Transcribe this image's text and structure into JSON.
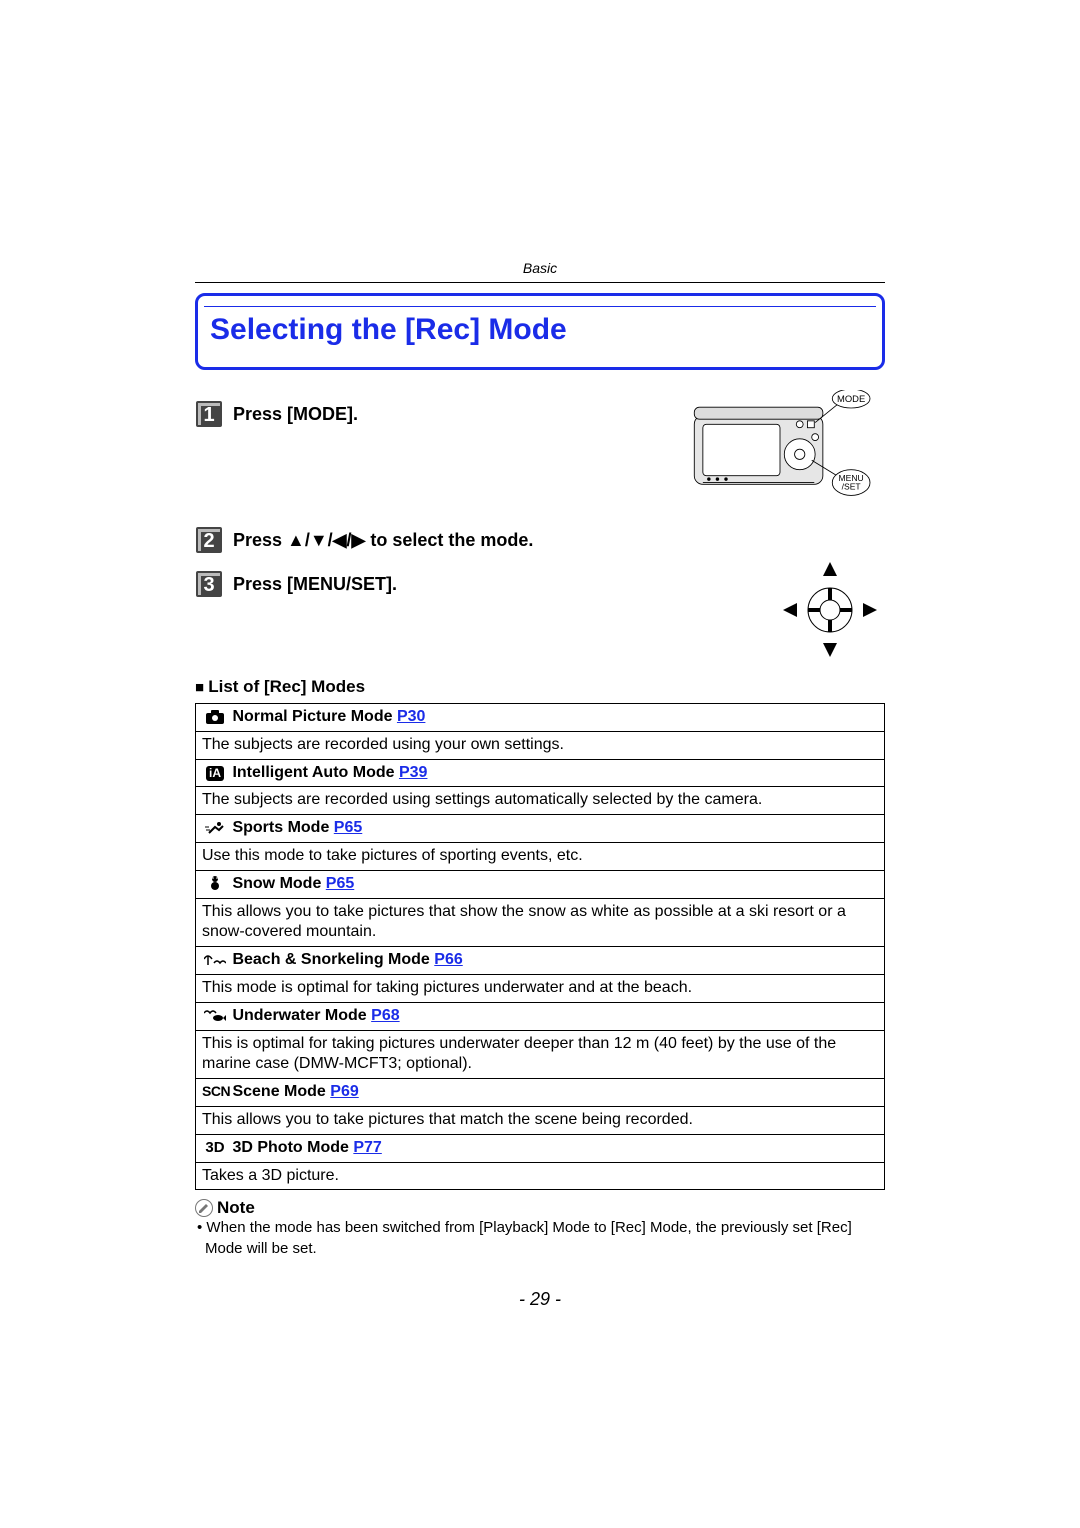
{
  "chapter": "Basic",
  "title": "Selecting the [Rec] Mode",
  "steps": [
    {
      "n": "1",
      "text": "Press [MODE]."
    },
    {
      "n": "2",
      "text": "Press ▲/▼/◀/▶ to select the mode."
    },
    {
      "n": "3",
      "text": "Press [MENU/SET]."
    }
  ],
  "buttons": {
    "mode": "MODE",
    "menu1": "MENU",
    "menu2": "/SET"
  },
  "list_heading": "List of [Rec] Modes",
  "modes": [
    {
      "icon": "camera-icon",
      "name": "Normal Picture Mode",
      "page": "P30",
      "desc": "The subjects are recorded using your own settings."
    },
    {
      "icon": "ia-icon",
      "name": "Intelligent Auto Mode",
      "page": "P39",
      "desc": "The subjects are recorded using settings automatically selected by the camera."
    },
    {
      "icon": "sports-icon",
      "name": "Sports Mode",
      "page": "P65",
      "desc": "Use this mode to take pictures of sporting events, etc."
    },
    {
      "icon": "snow-icon",
      "name": "Snow Mode",
      "page": "P65",
      "desc": "This allows you to take pictures that show the snow as white as possible at a ski resort or a snow-covered mountain."
    },
    {
      "icon": "beach-icon",
      "name": "Beach & Snorkeling Mode",
      "page": "P66",
      "desc": "This mode is optimal for taking pictures underwater and at the beach."
    },
    {
      "icon": "underwater-icon",
      "name": "Underwater Mode",
      "page": "P68",
      "desc": "This is optimal for taking pictures underwater deeper than 12  m (40 feet) by the use of the marine case (DMW-MCFT3; optional)."
    },
    {
      "icon": "scene-icon",
      "name": "Scene Mode",
      "page": "P69",
      "desc": "This allows you to take pictures that match the scene being recorded."
    },
    {
      "icon": "threeD-icon",
      "name": "3D Photo Mode",
      "page": "P77",
      "desc": "Takes a 3D picture."
    }
  ],
  "icons": {
    "ia": "iA",
    "scn": "SCN",
    "threeD": "3D"
  },
  "note_heading": "Note",
  "note_body": "When the mode has been switched from [Playback] Mode to [Rec] Mode, the previously set [Rec] Mode will be set.",
  "page_number": "- 29 -"
}
